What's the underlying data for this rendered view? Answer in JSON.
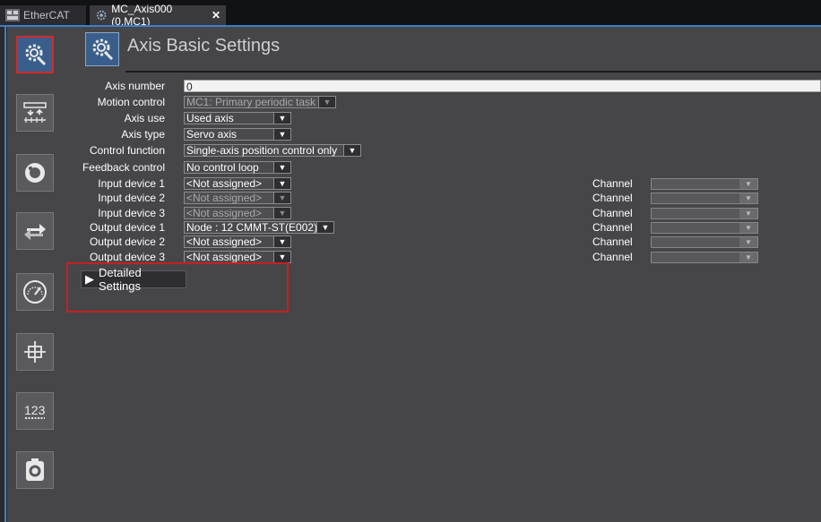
{
  "tabs": [
    {
      "label": "EtherCAT",
      "icon": "ethercat-icon"
    },
    {
      "label": "MC_Axis000 (0,MC1)",
      "icon": "axis-gear-icon",
      "close": "✕"
    }
  ],
  "header": {
    "title": "Axis Basic Settings",
    "icon": "axis-basic-settings-icon"
  },
  "sidebar": {
    "items": [
      {
        "name": "axis-basic-settings-icon",
        "active": true
      },
      {
        "name": "unit-conversion-icon"
      },
      {
        "name": "operation-settings-icon"
      },
      {
        "name": "other-operation-icon"
      },
      {
        "name": "limit-settings-icon"
      },
      {
        "name": "position-count-icon"
      },
      {
        "name": "servo-drive-icon"
      },
      {
        "name": "homing-icon"
      }
    ]
  },
  "form": {
    "axis_number": {
      "label": "Axis number",
      "value": "0"
    },
    "motion_control": {
      "label": "Motion control",
      "value": "MC1: Primary periodic task"
    },
    "axis_use": {
      "label": "Axis use",
      "value": "Used axis"
    },
    "axis_type": {
      "label": "Axis type",
      "value": "Servo axis"
    },
    "control_function": {
      "label": "Control function",
      "value": "Single-axis position control only"
    },
    "feedback_control": {
      "label": "Feedback control",
      "value": "No control loop"
    },
    "input_device_1": {
      "label": "Input device 1",
      "value": "<Not assigned>"
    },
    "input_device_2": {
      "label": "Input device 2",
      "value": "<Not assigned>"
    },
    "input_device_3": {
      "label": "Input device 3",
      "value": "<Not assigned>"
    },
    "output_device_1": {
      "label": "Output device 1",
      "value": "Node : 12 CMMT-ST(E002)"
    },
    "output_device_2": {
      "label": "Output device 2",
      "value": "<Not assigned>"
    },
    "output_device_3": {
      "label": "Output device 3",
      "value": "<Not assigned>"
    }
  },
  "channel": {
    "label": "Channel"
  },
  "detailed": {
    "arrow": "▶",
    "label": "Detailed Settings"
  },
  "colors": {
    "accent": "#3c7fc9",
    "highlight": "#c62020",
    "panel": "#464649"
  }
}
